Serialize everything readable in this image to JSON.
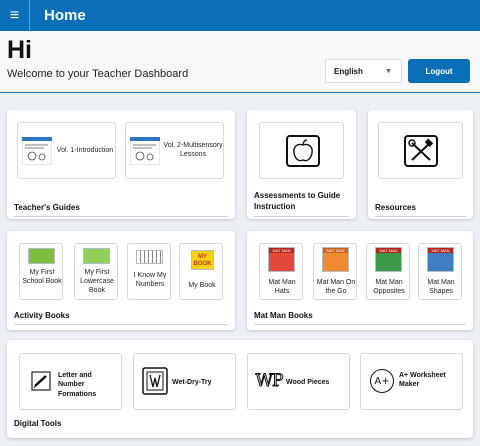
{
  "topbar": {
    "menu_icon": "≡",
    "title": "Home"
  },
  "header": {
    "greeting": "Hi",
    "welcome": "Welcome to your Teacher Dashboard",
    "language": {
      "selected": "English",
      "caret": "▼"
    },
    "logout_label": "Logout"
  },
  "teachers_guides": {
    "title": "Teacher's Guides",
    "items": [
      {
        "label": "Vol. 1-Introduction"
      },
      {
        "label": "Vol. 2-Multisensory Lessons"
      }
    ]
  },
  "assessments": {
    "title": "Assessments to Guide Instruction",
    "icon": "apple-icon"
  },
  "resources": {
    "title": "Resources",
    "icon": "tools-icon"
  },
  "activity_books": {
    "title": "Activity Books",
    "items": [
      {
        "label": "My First School Book",
        "cover_color": "#7cbf3f"
      },
      {
        "label": "My First Lowercase Book",
        "cover_color": "#8fcf5a"
      },
      {
        "label": "I Know My Numbers",
        "cover_color": "#ffffff"
      },
      {
        "label": "My Book",
        "cover_color": "#f4d20d",
        "cover_text": "MY BOOK"
      }
    ]
  },
  "mat_man_books": {
    "title": "Mat Man Books",
    "cover_header": "MAT MAN",
    "items": [
      {
        "label": "Mat Man Hats",
        "cover_color": "#e2493b"
      },
      {
        "label": "Mat Man On the Go",
        "cover_color": "#f08a2c"
      },
      {
        "label": "Mat Man Opposites",
        "cover_color": "#3a9a4a"
      },
      {
        "label": "Mat Man Shapes",
        "cover_color": "#3f7fc1"
      }
    ]
  },
  "digital_tools": {
    "title": "Digital Tools",
    "items": [
      {
        "label": "Letter and Number Formations",
        "icon": "pencil-icon"
      },
      {
        "label": "Wet-Dry-Try",
        "icon": "wet-dry-try-icon"
      },
      {
        "label": "Wood Pieces",
        "icon": "wood-pieces-icon",
        "glyph": "WP"
      },
      {
        "label": "A+ Worksheet Maker",
        "icon": "a-plus-icon",
        "glyph": "A+"
      }
    ]
  },
  "colors": {
    "brand_blue": "#0a6fb6",
    "background": "#eceff3"
  }
}
